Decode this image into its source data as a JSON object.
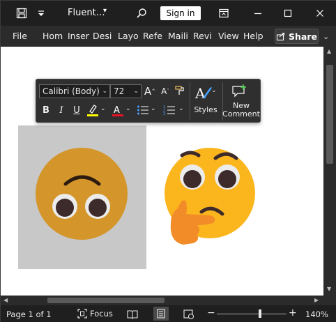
{
  "title_bar": {
    "doc_title": "Fluent…",
    "sign_in_label": "Sign in",
    "icons": [
      "save-icon",
      "customize-quick-access-icon",
      "search-icon",
      "ribbon-display-icon",
      "minimize-icon",
      "maximize-icon",
      "close-icon"
    ]
  },
  "ribbon": {
    "tabs": [
      "File",
      "Hom",
      "Inser",
      "Desi",
      "Layo",
      "Refe",
      "Maili",
      "Revi",
      "View",
      "Help"
    ],
    "share_label": "Share"
  },
  "mini_toolbar": {
    "font_name": "Calibri (Body)",
    "font_size": "72",
    "styles_label": "Styles",
    "new_comment_line1": "New",
    "new_comment_line2": "Comment",
    "highlight_color": "#ffff00",
    "font_color": "#e81123"
  },
  "status_bar": {
    "page_info": "Page 1 of 1",
    "focus_label": "Focus",
    "zoom_level": "140%",
    "zoom_fraction": 0.62
  },
  "colors": {
    "emoji_left_face": "#d4962a",
    "emoji_right_face": "#fbb61e",
    "hand": "#f28c28",
    "image_bg": "#c8c8c8"
  }
}
